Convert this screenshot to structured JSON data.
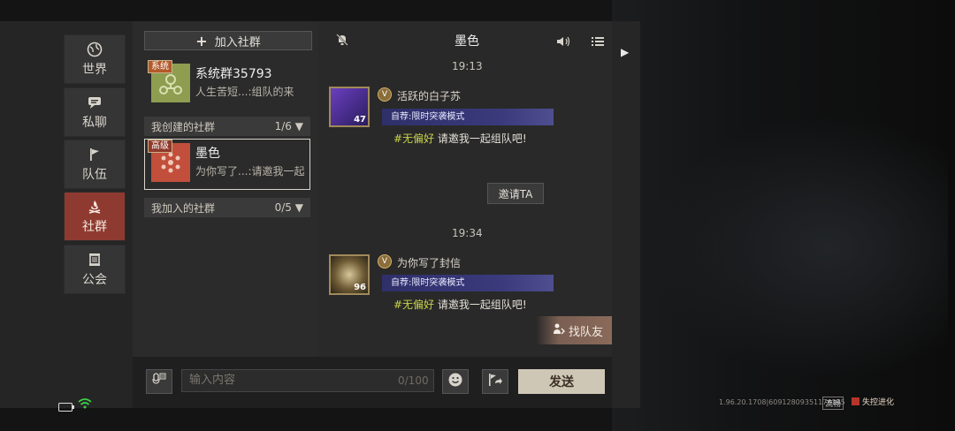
{
  "nav": [
    {
      "label": "世界",
      "icon": "globe-icon"
    },
    {
      "label": "私聊",
      "icon": "chat-bubble-icon"
    },
    {
      "label": "队伍",
      "icon": "flag-icon"
    },
    {
      "label": "社群",
      "icon": "campfire-icon",
      "active": true
    },
    {
      "label": "公会",
      "icon": "banner-icon"
    }
  ],
  "groups": {
    "add_label": "加入社群",
    "system": {
      "tag": "系统",
      "name": "系统群35793",
      "preview": "人生苦短...:组队的来"
    },
    "created_section": {
      "label": "我创建的社群",
      "count": "1/6"
    },
    "created": [
      {
        "tag": "高级",
        "name": "墨色",
        "preview": "为你写了...:请邀我一起"
      }
    ],
    "joined_section": {
      "label": "我加入的社群",
      "count": "0/5"
    }
  },
  "chat": {
    "title": "墨色",
    "messages": [
      {
        "time": "19:13",
        "name": "活跃的白子苏",
        "level": "47",
        "recruit": "自荐:限时突袭模式",
        "hashtag": "#无偏好",
        "text": " 请邀我一起组队吧!"
      },
      {
        "time": "19:34",
        "name": "为你写了封信",
        "level": "96",
        "recruit": "自荐:限时突袭模式",
        "hashtag": "#无偏好",
        "text": " 请邀我一起组队吧!"
      }
    ],
    "invite_label": "邀请TA",
    "find_team_label": "找队友"
  },
  "input": {
    "placeholder": "输入内容",
    "counter": "0/100",
    "send_label": "发送"
  },
  "footer": {
    "version": "1.96.20.1708|60912809351176195",
    "flow": "流畅",
    "logo": "失控进化"
  },
  "colors": {
    "active_nav": "#8f3a30",
    "hashtag": "#c8d34a",
    "send": "#cfc7b6"
  }
}
